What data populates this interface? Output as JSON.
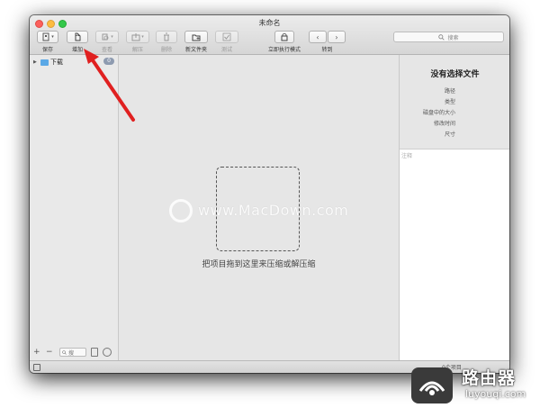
{
  "window": {
    "title": "未命名",
    "traffic_lights": {
      "close": "#fc605c",
      "minimize": "#fdbc40",
      "maximize": "#34c84a"
    }
  },
  "toolbar": {
    "save_label": "保存",
    "add_label": "增加",
    "view_label": "查看",
    "extract_label": "解压",
    "delete_label": "删除",
    "new_folder_label": "新文件夹",
    "test_label": "测试",
    "immediate_mode_label": "立即执行模式",
    "goto_label": "转到",
    "search_placeholder": "搜索"
  },
  "sidebar": {
    "items": [
      {
        "label": "下载",
        "badge": "0",
        "icon": "folder-icon"
      }
    ],
    "search_placeholder": "搜"
  },
  "main": {
    "drop_hint": "把项目拖到这里来压缩或解压缩",
    "watermark": "www.MacDown.com"
  },
  "info_panel": {
    "title": "没有选择文件",
    "fields": [
      "路径",
      "类型",
      "磁盘中的大小",
      "修改时间",
      "尺寸"
    ],
    "notes_placeholder": "注释"
  },
  "statusbar": {
    "text": "0个项目"
  },
  "corner_logo": {
    "name": "路由器",
    "url": "luyouqi.com"
  },
  "colors": {
    "annotation_arrow": "#e02020",
    "folder": "#5aa8e6",
    "badge": "#8e9bb0"
  }
}
